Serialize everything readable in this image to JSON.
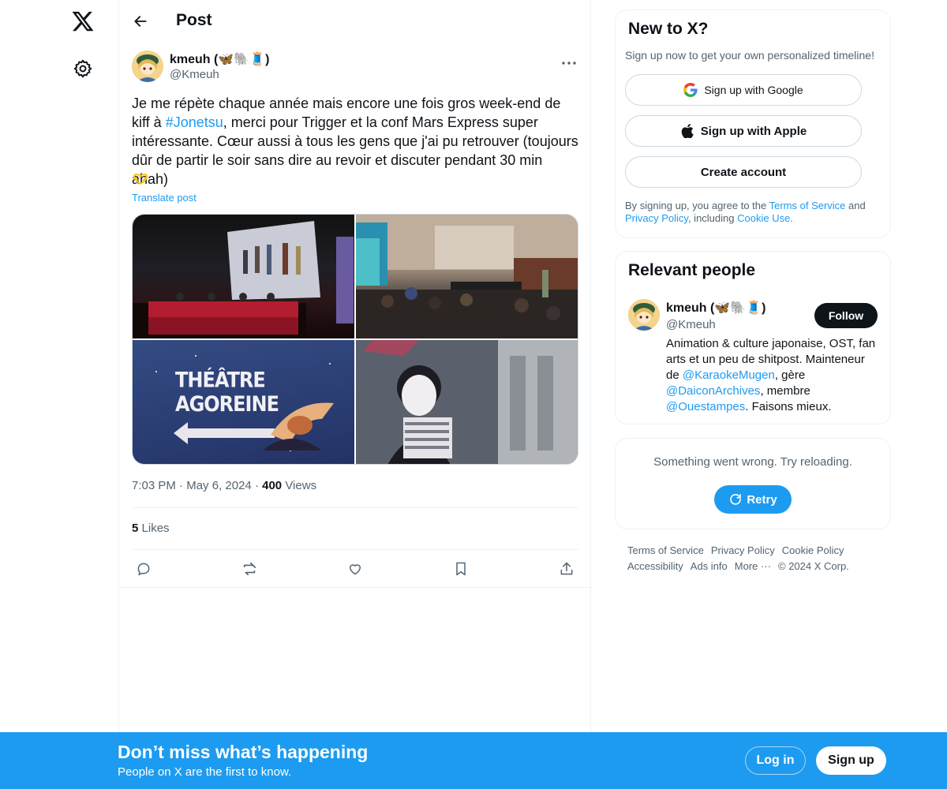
{
  "header": {
    "title": "Post"
  },
  "post": {
    "author": {
      "name": "kmeuh (🦋🐘🧵)",
      "handle": "@Kmeuh"
    },
    "text_before": "Je me répète chaque année mais encore une fois gros week-end de kiff à ",
    "hashtag": "#Jonetsu",
    "text_after": ", merci pour Trigger et la conf Mars Express super intéressante. Cœur aussi à tous les gens que j'ai pu retrouver (toujours dûr de partir le soir sans dire au revoir et discuter pendant 30 min ahah)",
    "translate": "Translate post",
    "media_caption_sign": "THÉÂTRE AGOREINE",
    "time": "7:03 PM",
    "dot": "·",
    "date": "May 6, 2024",
    "views_count": "400",
    "views_label": "Views",
    "likes_count": "5",
    "likes_label": "Likes"
  },
  "signup_card": {
    "title": "New to X?",
    "subtitle": "Sign up now to get your own personalized timeline!",
    "google_label": "Sign up with Google",
    "apple_label": "Sign up with Apple",
    "create_label": "Create account",
    "legal_prefix": "By signing up, you agree to the ",
    "terms": "Terms of Service",
    "and": " and ",
    "privacy": "Privacy Policy",
    "including": ", including ",
    "cookie": "Cookie Use."
  },
  "relevant": {
    "title": "Relevant people",
    "name": "kmeuh (🦋🐘🧵)",
    "handle": "@Kmeuh",
    "follow": "Follow",
    "bio_1": "Animation & culture japonaise, OST, fan arts et un peu de shitpost. Mainteneur de ",
    "bio_link1": "@KaraokeMugen",
    "bio_2": ", gère ",
    "bio_link2": "@DaiconArchives",
    "bio_3": ", membre ",
    "bio_link3": "@Ouestampes",
    "bio_4": ". Faisons mieux."
  },
  "error_card": {
    "message": "Something went wrong. Try reloading.",
    "retry": "Retry"
  },
  "footer": {
    "links": [
      "Terms of Service",
      "Privacy Policy",
      "Cookie Policy",
      "Accessibility",
      "Ads info",
      "More ···",
      "© 2024 X Corp."
    ]
  },
  "banner": {
    "title": "Don’t miss what’s happening",
    "subtitle": "People on X are the first to know.",
    "login": "Log in",
    "signup": "Sign up"
  },
  "colors": {
    "accent": "#1d9bf0",
    "text": "#0f1419",
    "muted": "#536471",
    "border": "#eff3f4"
  }
}
